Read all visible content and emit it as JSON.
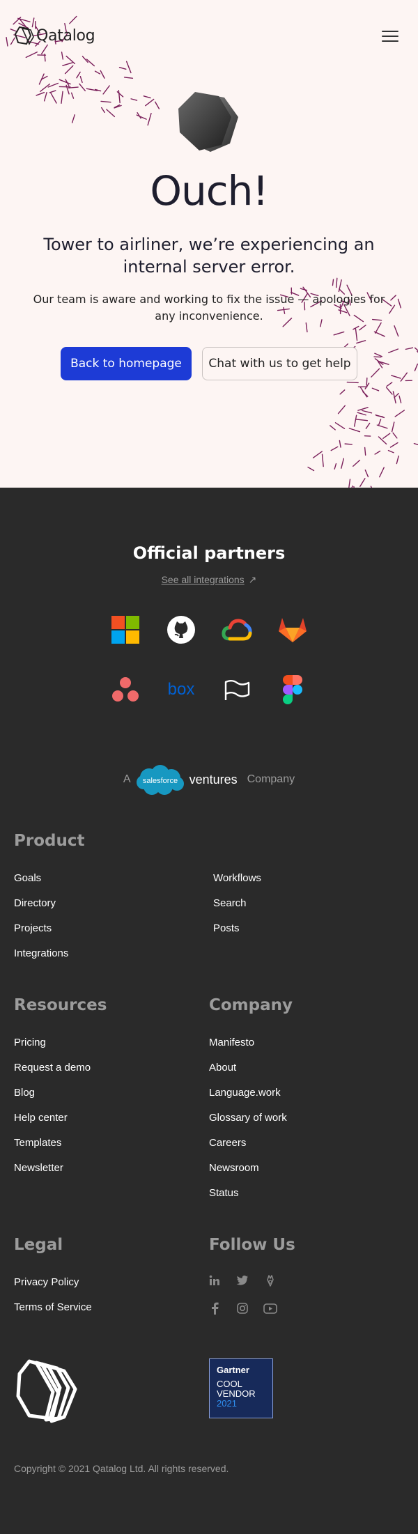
{
  "header": {
    "logo_text": "Qatalog",
    "menu_icon": "hamburger-menu-icon"
  },
  "error": {
    "title": "Ouch!",
    "subtitle": "Tower to airliner, we’re experiencing an internal server error.",
    "description": "Our team is aware and working to fix the issue — apologies for any inconvenience.",
    "primary_button": "Back to homepage",
    "secondary_button": "Chat with us to get help"
  },
  "partners": {
    "title": "Official partners",
    "see_all": "See all integrations",
    "see_all_icon": "arrow-up-right-icon",
    "logos": [
      "microsoft",
      "github",
      "google-cloud",
      "gitlab",
      "asana",
      "box",
      "linear-flag",
      "figma"
    ],
    "box_text": "box"
  },
  "salesforce": {
    "prefix": "A",
    "cloud_text": "salesforce",
    "ventures": "ventures",
    "suffix": "Company",
    "brand_color": "#1798c1"
  },
  "product": {
    "heading": "Product",
    "links_left": [
      "Goals",
      "Directory",
      "Projects",
      "Integrations"
    ],
    "links_right": [
      "Workflows",
      "Search",
      "Posts"
    ]
  },
  "resources": {
    "heading": "Resources",
    "links": [
      "Pricing",
      "Request a demo",
      "Blog",
      "Help center",
      "Templates",
      "Newsletter"
    ]
  },
  "company": {
    "heading": "Company",
    "links": [
      "Manifesto",
      "About",
      "Language.work",
      "Glossary of work",
      "Careers",
      "Newsroom",
      "Status"
    ]
  },
  "legal": {
    "heading": "Legal",
    "links": [
      "Privacy Policy",
      "Terms of Service"
    ]
  },
  "follow": {
    "heading": "Follow Us",
    "icons": [
      "linkedin-icon",
      "twitter-icon",
      "producthunt-icon",
      "facebook-icon",
      "instagram-icon",
      "youtube-icon"
    ]
  },
  "gartner": {
    "brand": "Gartner",
    "line1": "COOL",
    "line2": "VENDOR",
    "year": "2021"
  },
  "footer": {
    "copyright": "Copyright © 2021 Qatalog Ltd. All rights reserved."
  },
  "colors": {
    "hero_bg": "#fdf5f3",
    "footer_bg": "#2a2a2a",
    "accent_blue": "#1d3bd6",
    "decor_purple": "#7a1f5a",
    "muted_text": "#9c9c9c"
  }
}
